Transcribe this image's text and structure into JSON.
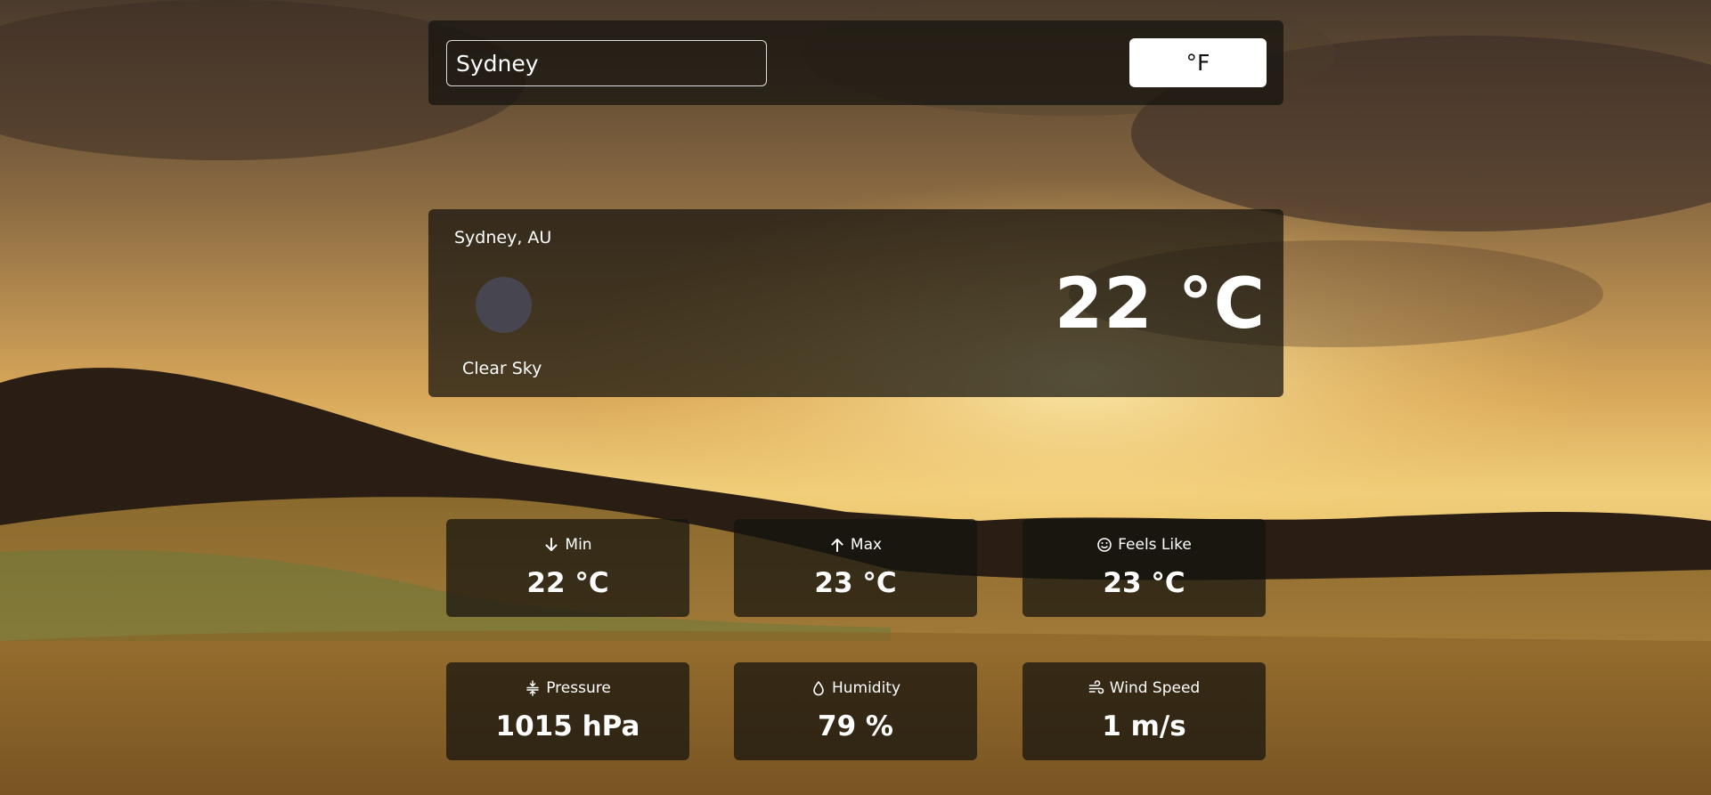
{
  "search": {
    "value": "Sydney",
    "placeholder": ""
  },
  "unit_toggle": {
    "label": "°F"
  },
  "current": {
    "location": "Sydney, AU",
    "temperature": "22 °C",
    "condition": "Clear Sky"
  },
  "stats": [
    {
      "icon": "arrow-down-icon",
      "label": "Min",
      "value": "22 °C"
    },
    {
      "icon": "arrow-up-icon",
      "label": "Max",
      "value": "23 °C"
    },
    {
      "icon": "smiley-icon",
      "label": "Feels Like",
      "value": "23 °C"
    },
    {
      "icon": "pressure-icon",
      "label": "Pressure",
      "value": "1015 hPa"
    },
    {
      "icon": "droplet-icon",
      "label": "Humidity",
      "value": "79 %"
    },
    {
      "icon": "wind-icon",
      "label": "Wind Speed",
      "value": "1 m/s"
    }
  ]
}
